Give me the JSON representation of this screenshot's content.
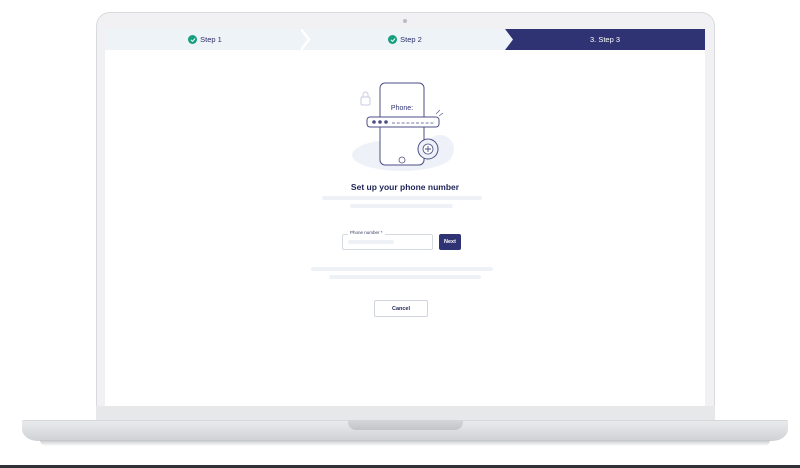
{
  "stepper": {
    "steps": [
      {
        "label": "Step 1",
        "state": "completed"
      },
      {
        "label": "Step 2",
        "state": "completed"
      },
      {
        "label": "3. Step 3",
        "state": "active"
      }
    ]
  },
  "illustration": {
    "phone_label": "Phone:"
  },
  "main": {
    "title": "Set up your phone number"
  },
  "form": {
    "phone_label": "Phone number *",
    "next_label": "Next",
    "cancel_label": "Cancel"
  },
  "colors": {
    "primary": "#2f3373",
    "success": "#17a07e",
    "stepper_bg": "#eef3f8"
  }
}
